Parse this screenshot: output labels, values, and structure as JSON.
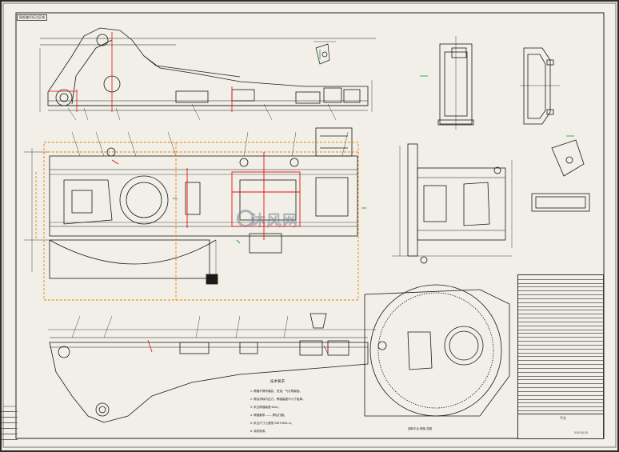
{
  "sheet": {
    "corner_label": "图纸编号标注区域",
    "watermark_text": "沐风网",
    "colors": {
      "background": "#f1efe7",
      "line": "#1a1a1a",
      "red": "#e01010",
      "orange": "#f08000",
      "green": "#1a9a30",
      "dark_frame": "#2c2c2c"
    }
  },
  "notes": {
    "title": "技术要求",
    "lines": [
      "1. 焊缝不得有裂纹、夹渣、气孔等缺陷。",
      "2. 焊后消除内应力，焊缝高度不小于板厚。",
      "3. 未注焊缝高度 6mm。",
      "4. 焊缝要求 —— 焊后打磨。",
      "5. 未注尺寸公差按 GB/T1804-m。",
      "6. 涂防锈漆。"
    ]
  },
  "section_caption": "回转平台 焊接 总图",
  "bom": {
    "rows": 36,
    "header": [
      "序号",
      "代号",
      "名称",
      "数量",
      "材料",
      "备注"
    ]
  },
  "title_block": {
    "name": "平台",
    "code": "XXX-00-00"
  },
  "revision_block": {
    "rows": [
      "",
      "",
      "",
      "",
      "",
      ""
    ]
  },
  "icons": [
    "watermark-logo-icon"
  ]
}
